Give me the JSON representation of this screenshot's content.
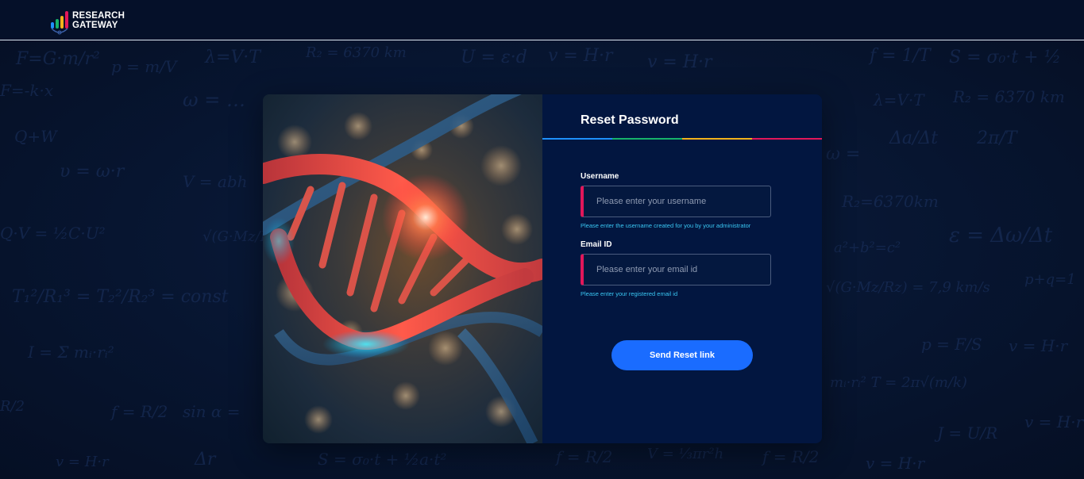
{
  "header": {
    "logo_line1": "RESEARCH",
    "logo_line2": "GATEWAY",
    "logo_icon": "bar-chart-logo-icon"
  },
  "hero": {
    "image_subject": "DNA double helix"
  },
  "form": {
    "title": "Reset Password",
    "accent_colors": [
      "#1e90ff",
      "#16b36b",
      "#f2b21c",
      "#e2175a"
    ],
    "username": {
      "label": "Username",
      "placeholder": "Please enter your username",
      "value": "",
      "hint": "Please enter the username created for you by your administrator"
    },
    "email": {
      "label": "Email ID",
      "placeholder": "Please enter your email id",
      "value": "",
      "hint": "Please enter your registered email id"
    },
    "submit_label": "Send Reset link"
  },
  "colors": {
    "background": "#06122b",
    "panel": "#021640",
    "button": "#1a6cff",
    "field_accent": "#e2175a",
    "hint": "#39c6f2"
  }
}
